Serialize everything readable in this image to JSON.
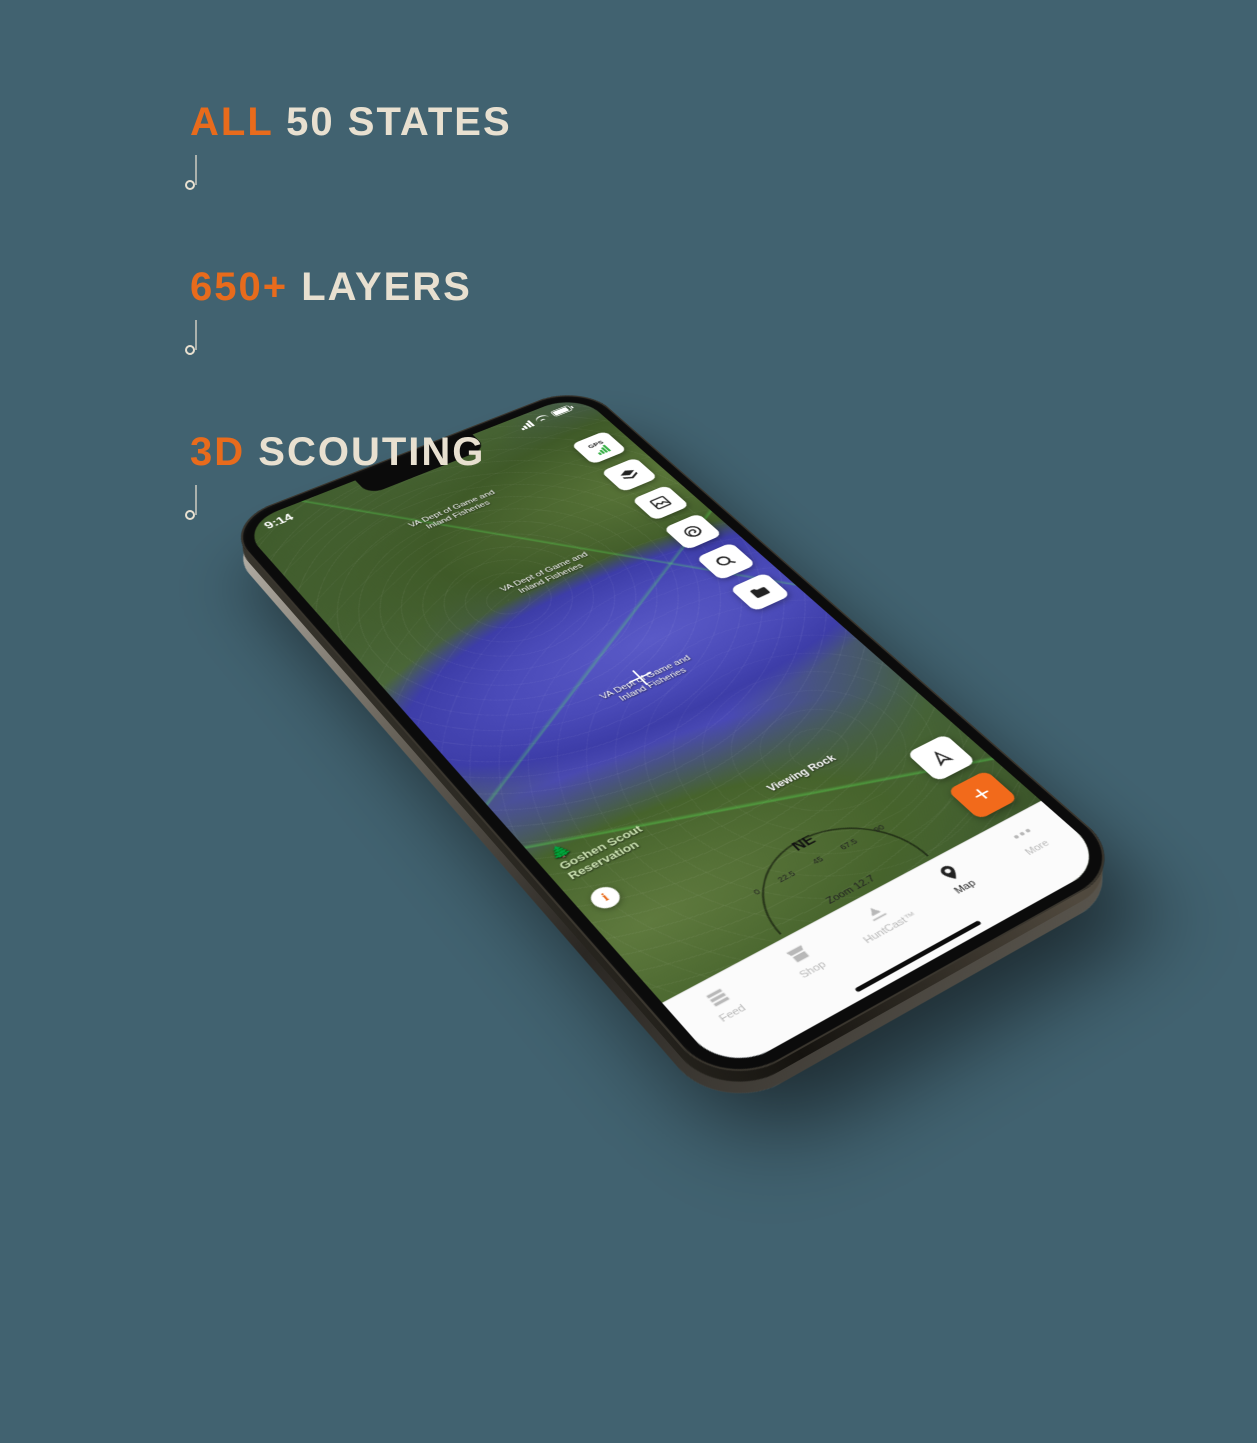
{
  "callouts": [
    {
      "accent": "ALL",
      "rest": "50 STATES"
    },
    {
      "accent": "650+",
      "rest": "LAYERS"
    },
    {
      "accent": "3D",
      "rest": "SCOUTING"
    }
  ],
  "status": {
    "time": "9:14"
  },
  "map": {
    "labels": {
      "agency_line1": "VA Dept of Game and",
      "agency_line2": "Inland Fisheries",
      "poi": "Viewing Rock",
      "park_line1": "Goshen Scout",
      "park_line2": "Reservation"
    },
    "info_glyph": "i"
  },
  "tools": {
    "gps_label": "GPS"
  },
  "compass": {
    "direction": "NE",
    "ticks": [
      "0",
      "22.5",
      "45",
      "67.5",
      "90"
    ],
    "zoom_label": "Zoom 12.7"
  },
  "float": {
    "add_glyph": "+"
  },
  "tabs": [
    {
      "id": "feed",
      "label": "Feed",
      "active": false
    },
    {
      "id": "shop",
      "label": "Shop",
      "active": false
    },
    {
      "id": "huntcast",
      "label": "HuntCast™",
      "active": false
    },
    {
      "id": "map",
      "label": "Map",
      "active": true
    },
    {
      "id": "more",
      "label": "More",
      "active": false
    }
  ]
}
